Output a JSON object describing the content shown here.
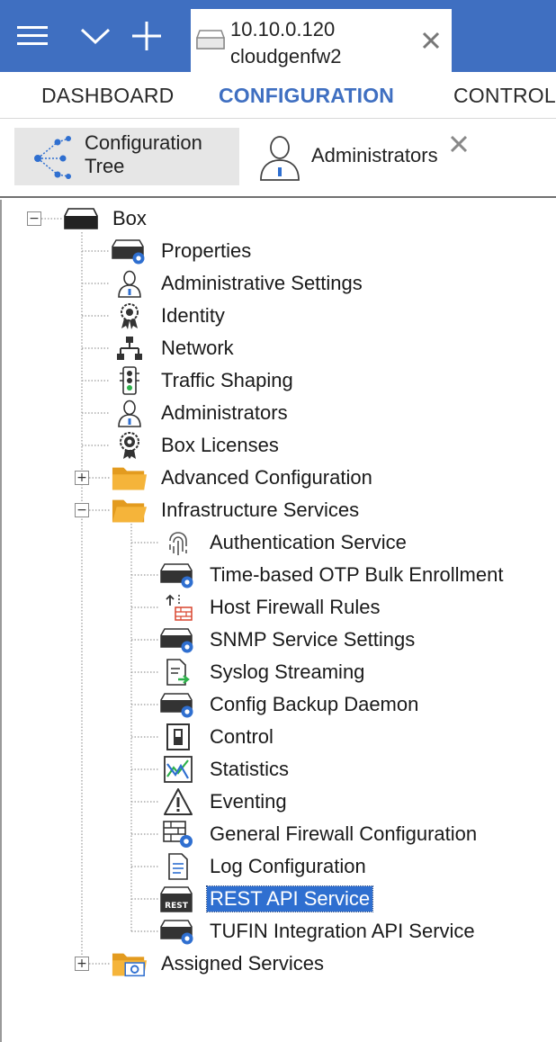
{
  "titlebar": {
    "menu_icon": "hamburger-icon",
    "chevron_icon": "chevron-down-icon",
    "plus_icon": "plus-icon",
    "tab": {
      "ip": "10.10.0.120",
      "host": "cloudgenfw2",
      "icon": "server-icon",
      "close_icon": "close-icon"
    }
  },
  "nav": {
    "items": [
      "DASHBOARD",
      "CONFIGURATION",
      "CONTROL"
    ],
    "active": "CONFIGURATION"
  },
  "subbar": {
    "tabs": [
      {
        "line1": "Configuration",
        "line2": "Tree",
        "icon": "tree-network-icon",
        "active": true
      },
      {
        "label": "Administrators",
        "icon": "user-icon",
        "active": false
      }
    ],
    "close_icon": "close-icon"
  },
  "tree": {
    "root": {
      "label": "Box",
      "icon": "server-icon",
      "expanded": true
    },
    "children": [
      {
        "label": "Properties",
        "icon": "server-gear-icon"
      },
      {
        "label": "Administrative Settings",
        "icon": "user-icon"
      },
      {
        "label": "Identity",
        "icon": "badge-icon"
      },
      {
        "label": "Network",
        "icon": "network-icon"
      },
      {
        "label": "Traffic Shaping",
        "icon": "traffic-light-icon"
      },
      {
        "label": "Administrators",
        "icon": "user-icon"
      },
      {
        "label": "Box Licenses",
        "icon": "certificate-icon"
      },
      {
        "label": "Advanced Configuration",
        "icon": "folder-icon",
        "expanded": false
      },
      {
        "label": "Infrastructure Services",
        "icon": "folder-icon",
        "expanded": true
      },
      {
        "label": "Authentication Service",
        "icon": "fingerprint-icon",
        "level": 2
      },
      {
        "label": "Time-based OTP Bulk Enrollment",
        "icon": "server-gear-icon",
        "level": 2
      },
      {
        "label": "Host Firewall Rules",
        "icon": "firewall-icon",
        "level": 2
      },
      {
        "label": "SNMP Service Settings",
        "icon": "server-gear-icon",
        "level": 2
      },
      {
        "label": "Syslog Streaming",
        "icon": "document-arrow-icon",
        "level": 2
      },
      {
        "label": "Config Backup Daemon",
        "icon": "server-gear-icon",
        "level": 2
      },
      {
        "label": "Control",
        "icon": "switch-icon",
        "level": 2
      },
      {
        "label": "Statistics",
        "icon": "statistics-icon",
        "level": 2
      },
      {
        "label": "Eventing",
        "icon": "warning-icon",
        "level": 2
      },
      {
        "label": "General Firewall Configuration",
        "icon": "firewall-gear-icon",
        "level": 2
      },
      {
        "label": "Log Configuration",
        "icon": "document-icon",
        "level": 2
      },
      {
        "label": "REST API Service",
        "icon": "rest-api-icon",
        "level": 2,
        "selected": true
      },
      {
        "label": "TUFIN Integration API Service",
        "icon": "server-gear-icon",
        "level": 2
      },
      {
        "label": "Assigned Services",
        "icon": "folder-gear-icon",
        "expanded": false
      }
    ]
  },
  "colors": {
    "accent": "#3f6fc1",
    "selection": "#2f6fd0",
    "folder": "#f5b43a"
  }
}
